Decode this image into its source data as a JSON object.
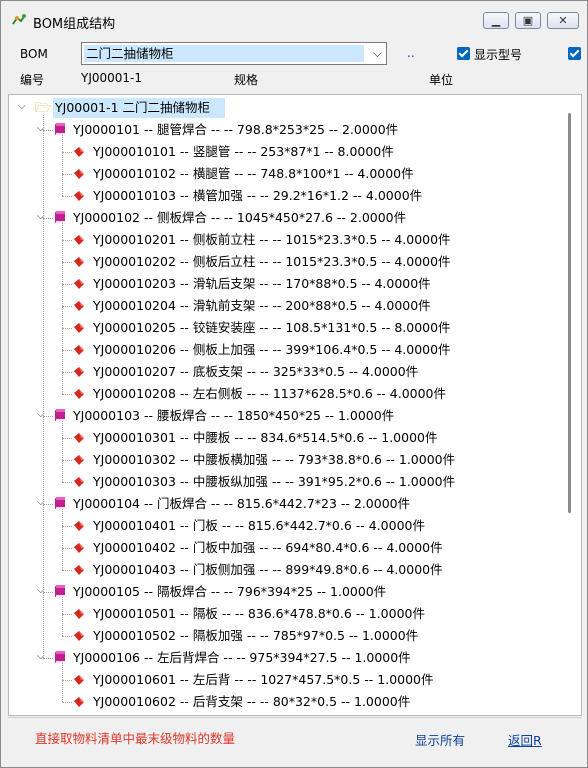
{
  "window": {
    "title": "BOM组成结构"
  },
  "form": {
    "bom_label": "BOM",
    "bom_value": "二门二抽储物柜",
    "dots": "..",
    "show_model_label": "显示型号",
    "code_label": "编号",
    "code_value": "YJ00001-1",
    "spec_label": "规格",
    "unit_label": "单位"
  },
  "tree": {
    "root": "YJ00001-1 二门二抽储物柜",
    "groups": [
      {
        "label": "YJ0000101 -- 腿管焊合 --  -- 798.8*253*25 -- 2.0000件",
        "children": [
          "YJ000010101 -- 竖腿管 --  -- 253*87*1 -- 8.0000件",
          "YJ000010102 -- 横腿管 --  -- 748.8*100*1 -- 4.0000件",
          "YJ000010103 -- 横管加强 --  -- 29.2*16*1.2 -- 4.0000件"
        ]
      },
      {
        "label": "YJ0000102 -- 侧板焊合 --  -- 1045*450*27.6 -- 2.0000件",
        "children": [
          "YJ000010201 -- 侧板前立柱 --  -- 1015*23.3*0.5 -- 4.0000件",
          "YJ000010202 -- 侧板后立柱 --  -- 1015*23.3*0.5 -- 4.0000件",
          "YJ000010203 -- 滑轨后支架 --  -- 170*88*0.5 -- 4.0000件",
          "YJ000010204 -- 滑轨前支架 --  -- 200*88*0.5 -- 4.0000件",
          "YJ000010205 -- 铰链安装座 --  -- 108.5*131*0.5 -- 8.0000件",
          "YJ000010206 -- 侧板上加强 --  -- 399*106.4*0.5 -- 4.0000件",
          "YJ000010207 -- 底板支架 --  -- 325*33*0.5 -- 4.0000件",
          "YJ000010208 -- 左右侧板 --  -- 1137*628.5*0.6 -- 4.0000件"
        ]
      },
      {
        "label": "YJ0000103 -- 腰板焊合 --  -- 1850*450*25 -- 1.0000件",
        "children": [
          "YJ000010301 -- 中腰板 --  -- 834.6*514.5*0.6 -- 1.0000件",
          "YJ000010302 -- 中腰板横加强 --  -- 793*38.8*0.6 -- 1.0000件",
          "YJ000010303 -- 中腰板纵加强 --  -- 391*95.2*0.6 -- 1.0000件"
        ]
      },
      {
        "label": "YJ0000104 -- 门板焊合 --  -- 815.6*442.7*23 -- 2.0000件",
        "children": [
          "YJ000010401 -- 门板 --  -- 815.6*442.7*0.6 -- 4.0000件",
          "YJ000010402 -- 门板中加强 --  -- 694*80.4*0.6 -- 4.0000件",
          "YJ000010403 -- 门板侧加强 --  -- 899*49.8*0.6 -- 4.0000件"
        ]
      },
      {
        "label": "YJ0000105 -- 隔板焊合 --  -- 796*394*25 -- 1.0000件",
        "children": [
          "YJ000010501 -- 隔板 --  -- 836.6*478.8*0.6 -- 1.0000件",
          "YJ000010502 -- 隔板加强 --  -- 785*97*0.5 -- 1.0000件"
        ]
      },
      {
        "label": "YJ0000106 -- 左后背焊合 --  -- 975*394*27.5 -- 1.0000件",
        "children": [
          "YJ000010601 -- 左后背 --  -- 1027*457.5*0.5 -- 1.0000件",
          "YJ000010602 -- 后背支架 --  -- 80*32*0.5 -- 1.0000件"
        ]
      }
    ]
  },
  "footer": {
    "status": "直接取物料清单中最末级物料的数量",
    "show_all": "显示所有",
    "back": "返回R"
  }
}
